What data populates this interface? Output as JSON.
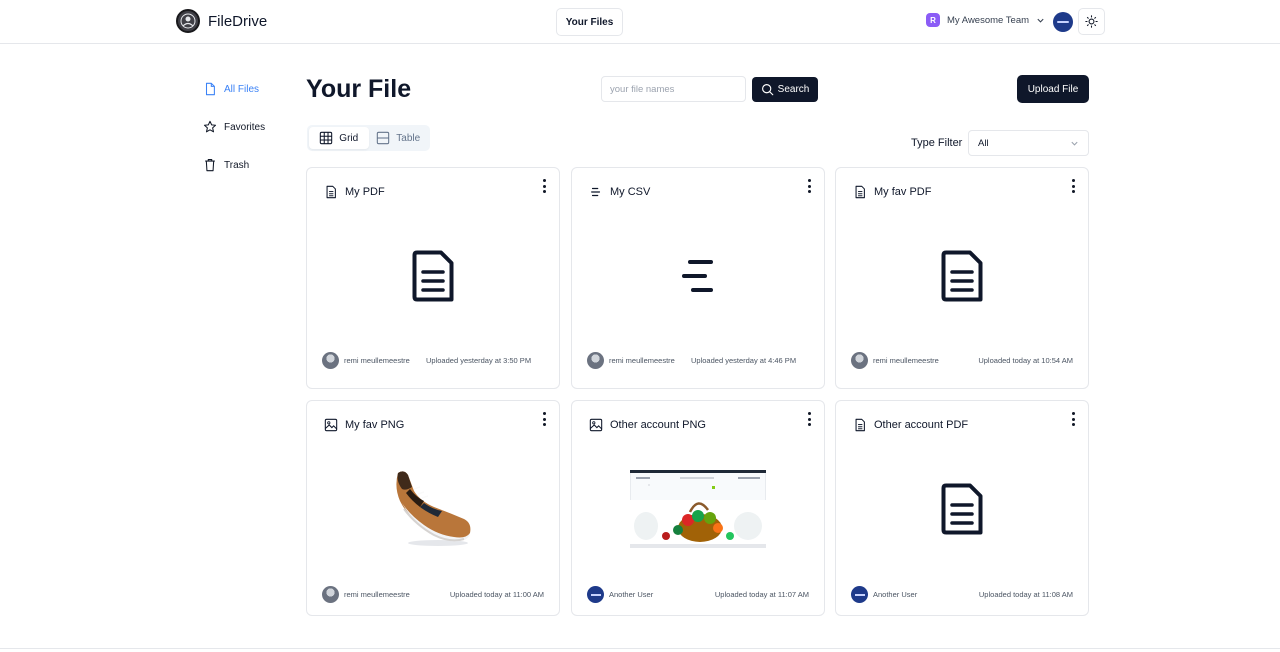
{
  "header": {
    "app_name": "FileDrive",
    "nav_button": "Your Files",
    "team_initial": "R",
    "team_name": "My Awesome Team"
  },
  "sidebar": {
    "items": [
      {
        "label": "All Files",
        "icon": "file-icon",
        "active": true
      },
      {
        "label": "Favorites",
        "icon": "star-icon",
        "active": false
      },
      {
        "label": "Trash",
        "icon": "trash-icon",
        "active": false
      }
    ]
  },
  "main": {
    "title": "Your File",
    "search_placeholder": "your file names",
    "search_button": "Search",
    "upload_button": "Upload File",
    "tabs": [
      {
        "label": "Grid",
        "active": true
      },
      {
        "label": "Table",
        "active": false
      }
    ],
    "filter_label": "Type Filter",
    "filter_value": "All"
  },
  "files": [
    {
      "name": "My PDF",
      "type": "pdf",
      "user": "remi meullemeestre",
      "uploaded": "Uploaded yesterday at 3:50 PM"
    },
    {
      "name": "My CSV",
      "type": "csv",
      "user": "remi meullemeestre",
      "uploaded": "Uploaded yesterday at 4:46 PM"
    },
    {
      "name": "My fav PDF",
      "type": "pdf",
      "user": "remi meullemeestre",
      "uploaded": "Uploaded today at 10:54 AM"
    },
    {
      "name": "My fav PNG",
      "type": "png",
      "user": "remi meullemeestre",
      "uploaded": "Uploaded today at 11:00 AM"
    },
    {
      "name": "Other account PNG",
      "type": "png",
      "user": "Another User",
      "uploaded": "Uploaded today at 11:07 AM"
    },
    {
      "name": "Other account PDF",
      "type": "pdf",
      "user": "Another User",
      "uploaded": "Uploaded today at 11:08 AM"
    }
  ],
  "colors": {
    "primary": "#0f172a",
    "accent": "#3b82f6",
    "team_badge": "#8b5cf6",
    "border": "#e5e7eb"
  }
}
